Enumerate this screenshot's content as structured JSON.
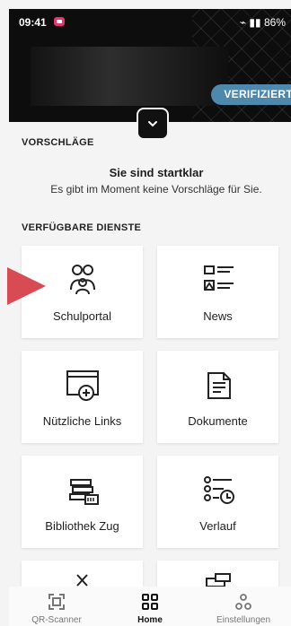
{
  "statusbar": {
    "time": "09:41",
    "battery": "86%"
  },
  "header": {
    "badge": "VERIFIZIERT"
  },
  "sections": {
    "suggestions": "VORSCHLÄGE",
    "services": "VERFÜGBARE DIENSTE"
  },
  "empty": {
    "title": "Sie sind startklar",
    "subtitle": "Es gibt im Moment keine Vorschläge für Sie."
  },
  "cards": [
    "Schulportal",
    "News",
    "Nützliche Links",
    "Dokumente",
    "Bibliothek Zug",
    "Verlauf"
  ],
  "nav": [
    "QR-Scanner",
    "Home",
    "Einstellungen"
  ]
}
